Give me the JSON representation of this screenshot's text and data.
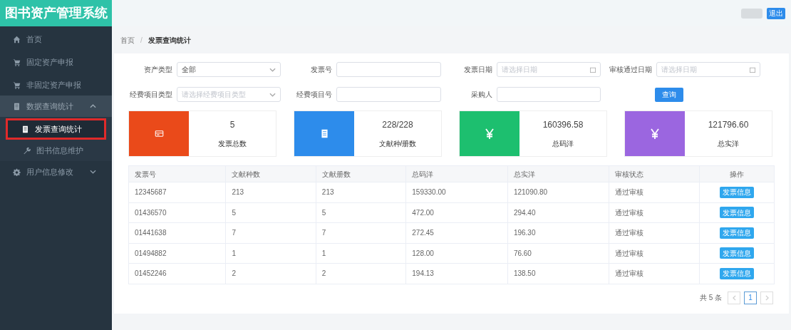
{
  "app": {
    "title": "图书资产管理系统"
  },
  "sidebar": {
    "items": [
      {
        "label": "首页",
        "kind": "home",
        "selected": false
      },
      {
        "label": "固定资产申报",
        "kind": "cart",
        "selected": false
      },
      {
        "label": "非固定资产申报",
        "kind": "cart",
        "selected": false
      },
      {
        "label": "数据查询统计",
        "kind": "doc",
        "selected": false,
        "expanded": true,
        "children": [
          {
            "label": "发票查询统计",
            "kind": "doc",
            "selected": true
          },
          {
            "label": "图书信息维护",
            "kind": "wrench",
            "selected": false
          }
        ]
      },
      {
        "label": "用户信息修改",
        "kind": "gear",
        "selected": false,
        "expanded": false
      }
    ]
  },
  "header": {
    "logout": "退出"
  },
  "breadcrumb": {
    "items": [
      "首页",
      "发票查询统计"
    ],
    "separator": "/"
  },
  "filters": [
    {
      "label": "资产类型",
      "kind": "select",
      "value": "全部"
    },
    {
      "label": "发票号",
      "kind": "text"
    },
    {
      "label": "发票日期",
      "kind": "date",
      "placeholder": "请选择日期"
    },
    {
      "label": "审核通过日期",
      "kind": "date",
      "placeholder": "请选择日期"
    },
    {
      "label": "经费项目类型",
      "kind": "select",
      "placeholder": "请选择经费项目类型"
    },
    {
      "label": "经费项目号",
      "kind": "text"
    },
    {
      "label": "采购人",
      "kind": "text"
    }
  ],
  "search_button": "查询",
  "stats": [
    {
      "value": "5",
      "label": "发票总数",
      "color": "#ea4a1a",
      "kind": "card"
    },
    {
      "value": "228/228",
      "label": "文献种/册数",
      "color": "#2d8ceb",
      "kind": "doc"
    },
    {
      "value": "160396.58",
      "label": "总码洋",
      "color": "#1dbf6f",
      "kind": "yen"
    },
    {
      "value": "121796.60",
      "label": "总实洋",
      "color": "#9b66e0",
      "kind": "yen"
    }
  ],
  "table": {
    "columns": [
      "发票号",
      "文献种数",
      "文献册数",
      "总码洋",
      "总实洋",
      "审核状态",
      "操作"
    ],
    "rows": [
      {
        "cells": [
          "12345687",
          "213",
          "213",
          "159330.00",
          "121090.80",
          "通过审核"
        ],
        "action": "发票信息"
      },
      {
        "cells": [
          "01436570",
          "5",
          "5",
          "472.00",
          "294.40",
          "通过审核"
        ],
        "action": "发票信息"
      },
      {
        "cells": [
          "01441638",
          "7",
          "7",
          "272.45",
          "196.30",
          "通过审核"
        ],
        "action": "发票信息"
      },
      {
        "cells": [
          "01494882",
          "1",
          "1",
          "128.00",
          "76.60",
          "通过审核"
        ],
        "action": "发票信息"
      },
      {
        "cells": [
          "01452246",
          "2",
          "2",
          "194.13",
          "138.50",
          "通过审核"
        ],
        "action": "发票信息"
      }
    ]
  },
  "pagination": {
    "total": "共 5 条",
    "pages": [
      {
        "label": "1",
        "selected": true
      }
    ]
  }
}
